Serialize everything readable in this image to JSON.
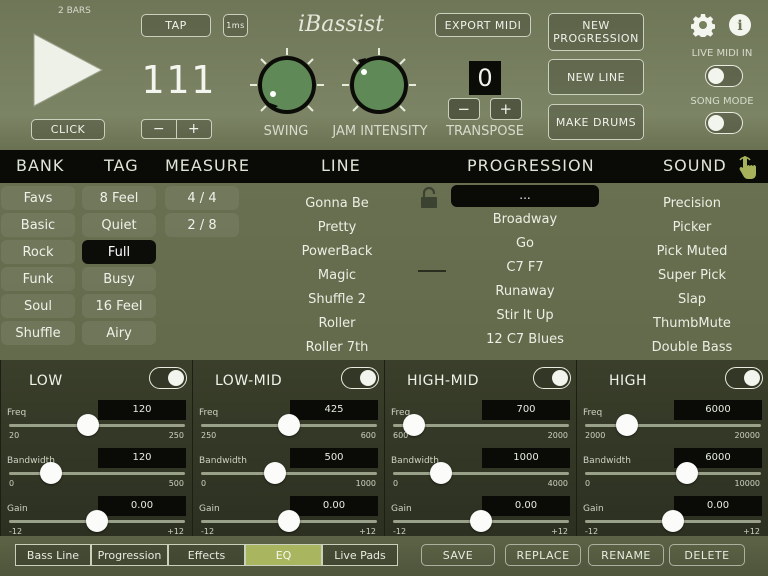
{
  "top": {
    "bars_label": "2 BARS",
    "click_label": "CLICK",
    "tap_label": "TAP",
    "tempo_small": "1ms",
    "tempo_value": "111",
    "minus": "−",
    "plus": "+",
    "logo": "iBassist",
    "export_label": "EXPORT MIDI",
    "new_progression_label": "NEW\nPROGRESSION",
    "new_line_label": "NEW LINE",
    "make_drums_label": "MAKE DRUMS",
    "swing_label": "SWING",
    "jam_label": "JAM INTENSITY",
    "transpose_value": "0",
    "transpose_label": "TRANSPOSE",
    "live_midi_label": "LIVE MIDI IN",
    "song_mode_label": "SONG MODE"
  },
  "headers": {
    "bank": "BANK",
    "tag": "TAG",
    "measure": "MEASURE",
    "line": "LINE",
    "progression": "PROGRESSION",
    "sound": "SOUND"
  },
  "bank": [
    "Favs",
    "Basic",
    "Rock",
    "Funk",
    "Soul",
    "Shuffle"
  ],
  "tag": [
    "8 Feel",
    "Quiet",
    "Full",
    "Busy",
    "16 Feel",
    "Airy"
  ],
  "tag_selected": "Full",
  "measure": [
    "4 / 4",
    "2 / 8"
  ],
  "line": [
    "Gonna Be",
    "Pretty",
    "PowerBack",
    "Magic",
    "Shuffle 2",
    "Roller",
    "Roller 7th"
  ],
  "progression_selected": "...",
  "progression": [
    "Broadway",
    "Go",
    "C7 F7",
    "Runaway",
    "Stir It Up",
    "12 C7 Blues"
  ],
  "sound": [
    "Precision",
    "Picker",
    "Pick Muted",
    "Super Pick",
    "Slap",
    "ThumbMute",
    "Double Bass"
  ],
  "eq": [
    {
      "title": "LOW",
      "freq": "120",
      "freq_min": "20",
      "freq_max": "250",
      "freq_pos": 0.45,
      "bw": "120",
      "bw_min": "0",
      "bw_max": "500",
      "bw_pos": 0.24,
      "gain": "0.00",
      "gain_min": "-12",
      "gain_max": "+12",
      "gain_pos": 0.5
    },
    {
      "title": "LOW-MID",
      "freq": "425",
      "freq_min": "250",
      "freq_max": "600",
      "freq_pos": 0.5,
      "bw": "500",
      "bw_min": "0",
      "bw_max": "1000",
      "bw_pos": 0.42,
      "gain": "0.00",
      "gain_min": "-12",
      "gain_max": "+12",
      "gain_pos": 0.5
    },
    {
      "title": "HIGH-MID",
      "freq": "700",
      "freq_min": "600",
      "freq_max": "2000",
      "freq_pos": 0.12,
      "bw": "1000",
      "bw_min": "0",
      "bw_max": "4000",
      "bw_pos": 0.27,
      "gain": "0.00",
      "gain_min": "-12",
      "gain_max": "+12",
      "gain_pos": 0.5
    },
    {
      "title": "HIGH",
      "freq": "6000",
      "freq_min": "2000",
      "freq_max": "20000",
      "freq_pos": 0.24,
      "bw": "6000",
      "bw_min": "0",
      "bw_max": "10000",
      "bw_pos": 0.58,
      "gain": "0.00",
      "gain_min": "-12",
      "gain_max": "+12",
      "gain_pos": 0.5
    }
  ],
  "eq_labels": {
    "freq": "Freq",
    "bandwidth": "Bandwidth",
    "gain": "Gain"
  },
  "tabs": [
    "Bass Line",
    "Progression",
    "Effects",
    "EQ",
    "Live Pads"
  ],
  "tab_selected": "EQ",
  "actions": [
    "SAVE",
    "REPLACE",
    "RENAME",
    "DELETE"
  ]
}
